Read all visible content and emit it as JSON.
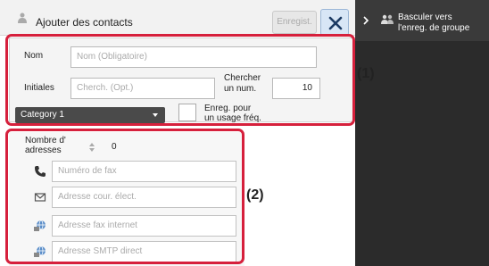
{
  "header": {
    "title": "Ajouter des contacts",
    "save_label": "Enregist.",
    "close_icon": "close-icon"
  },
  "form": {
    "name_label": "Nom",
    "name_placeholder": "Nom (Obligatoire)",
    "initials_label": "Initiales",
    "initials_placeholder": "Cherch. (Opt.)",
    "search_num_label_line1": "Chercher",
    "search_num_label_line2": "un num.",
    "search_num_value": "10",
    "category_value": "Category 1",
    "enreg_label_line1": "Enreg. pour",
    "enreg_label_line2": "un usage fréq."
  },
  "addresses": {
    "count_label_line1": "Nombre d'",
    "count_label_line2": "adresses",
    "count_value": "0",
    "fields": [
      {
        "icon": "phone-icon",
        "placeholder": "Numéro de fax"
      },
      {
        "icon": "envelope-icon",
        "placeholder": "Adresse cour. élect."
      },
      {
        "icon": "globe-icon",
        "placeholder": "Adresse fax internet"
      },
      {
        "icon": "globe-icon",
        "placeholder": "Adresse SMTP direct"
      }
    ]
  },
  "side": {
    "line1": "Basculer vers",
    "line2": "l'enreg. de groupe"
  },
  "annotations": {
    "label1": "(1)",
    "label2": "(2)"
  },
  "colors": {
    "highlight": "#d6203c",
    "panel": "#ffffff",
    "background": "#2b2b2b",
    "category_bg": "#4a4a4a",
    "close_bg": "#d8e6f6"
  }
}
